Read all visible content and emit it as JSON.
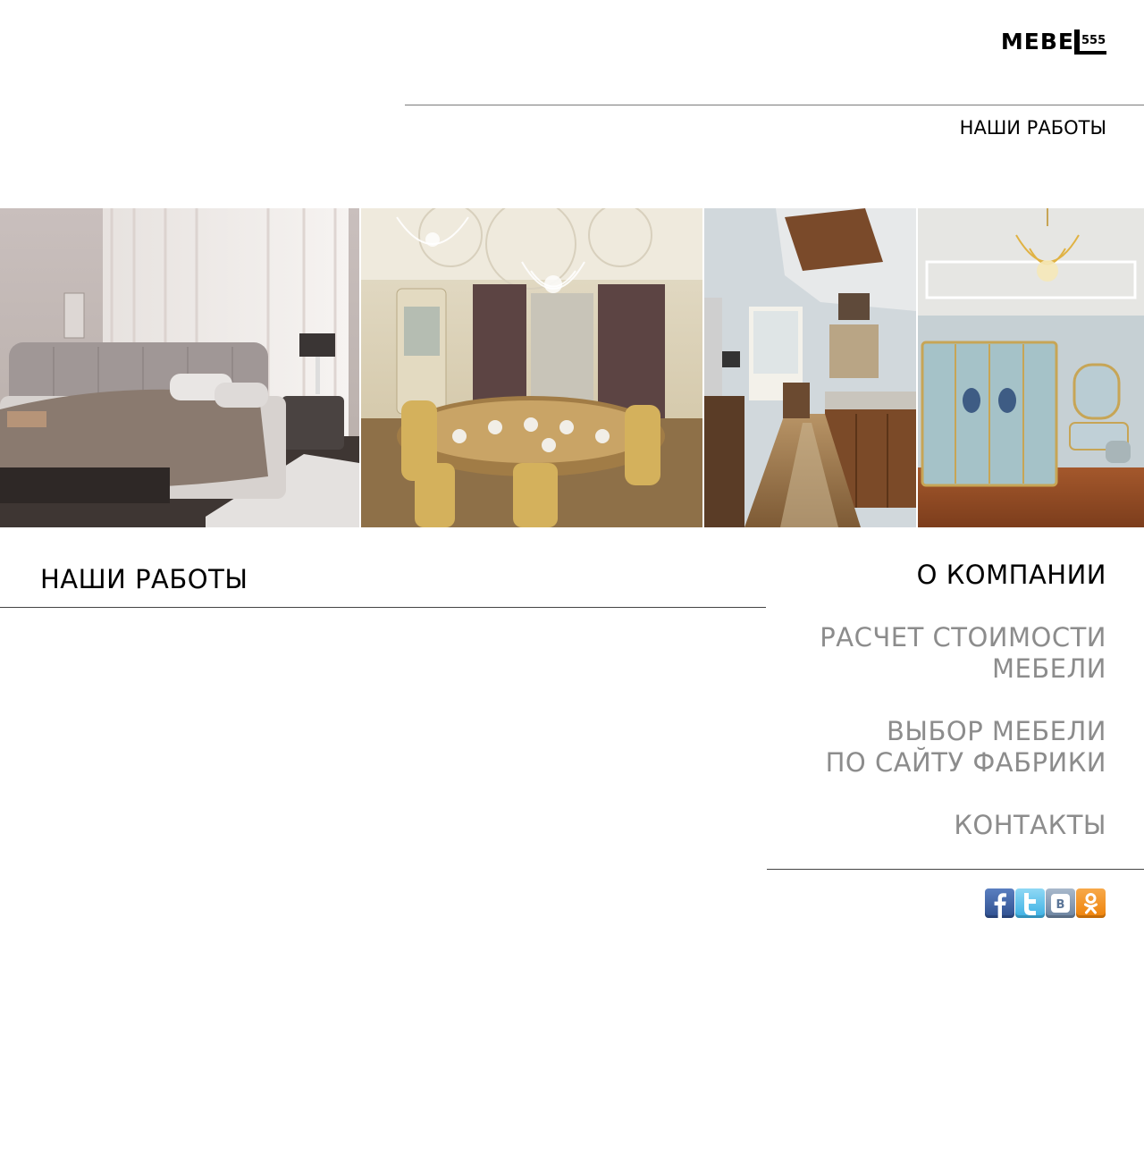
{
  "brand": {
    "name": "MEBEL",
    "word": "MEBE",
    "number": "555"
  },
  "header": {
    "top_link": "НАШИ РАБОТЫ"
  },
  "gallery": [
    {
      "name": "bedroom-photo"
    },
    {
      "name": "dining-room-photo"
    },
    {
      "name": "kitchen-photo"
    },
    {
      "name": "classic-bedroom-photo"
    }
  ],
  "section": {
    "title": "НАШИ РАБОТЫ"
  },
  "nav": {
    "about": "О КОМПАНИИ",
    "calc_line1": "РАСЧЕТ СТОИМОСТИ",
    "calc_line2": "МЕБЕЛИ",
    "choose_line1": "ВЫБОР МЕБЕЛИ",
    "choose_line2": "ПО САЙТУ ФАБРИКИ",
    "contacts": "КОНТАКТЫ"
  },
  "social": [
    {
      "icon": "facebook-icon"
    },
    {
      "icon": "twitter-icon"
    },
    {
      "icon": "vkontakte-icon"
    },
    {
      "icon": "odnoklassniki-icon"
    }
  ],
  "colors": {
    "text": "#000000",
    "nav_inactive": "#8c8c8c",
    "rule": "#444444"
  }
}
